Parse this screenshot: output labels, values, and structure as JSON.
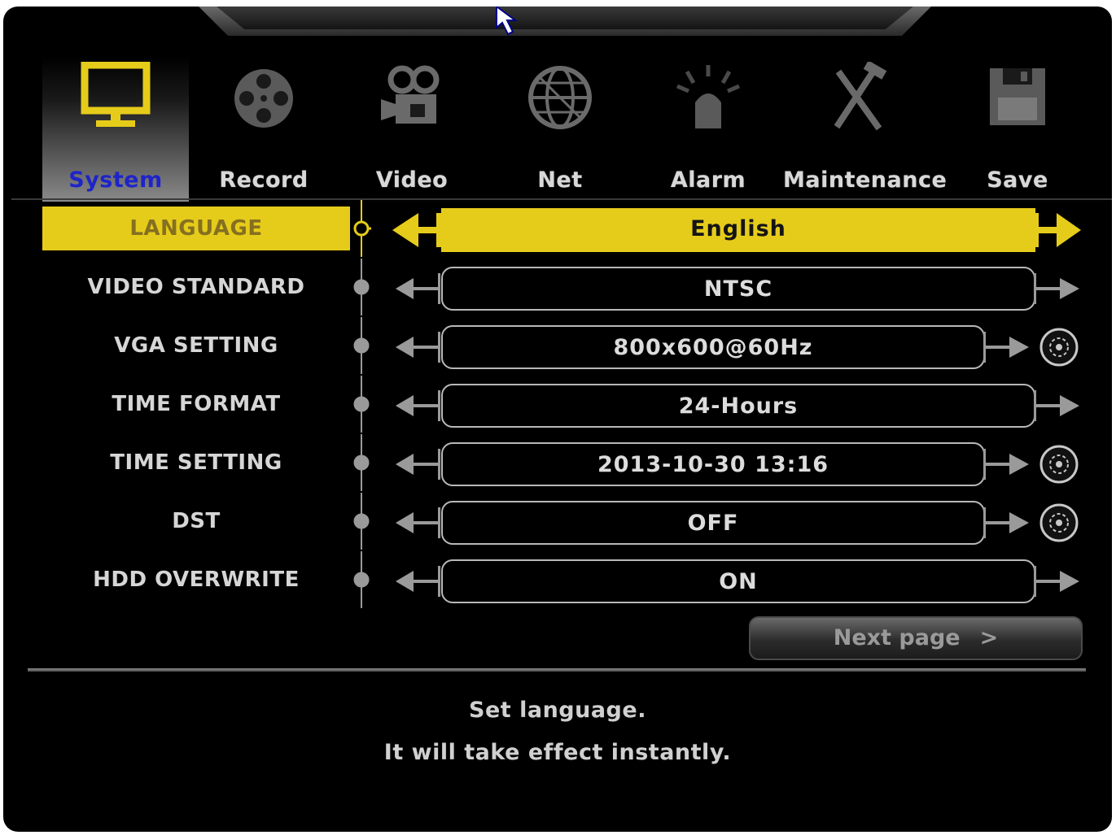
{
  "tabs": [
    {
      "id": "system",
      "label": "System",
      "icon": "monitor-icon",
      "active": true
    },
    {
      "id": "record",
      "label": "Record",
      "icon": "film-reel-icon",
      "active": false
    },
    {
      "id": "video",
      "label": "Video",
      "icon": "video-camera-icon",
      "active": false
    },
    {
      "id": "net",
      "label": "Net",
      "icon": "globe-icon",
      "active": false
    },
    {
      "id": "alarm",
      "label": "Alarm",
      "icon": "alarm-light-icon",
      "active": false
    },
    {
      "id": "maintenance",
      "label": "Maintenance",
      "icon": "tools-icon",
      "active": false
    },
    {
      "id": "save",
      "label": "Save",
      "icon": "floppy-disk-icon",
      "active": false
    }
  ],
  "settings": [
    {
      "label": "LANGUAGE",
      "value": "English",
      "active": true,
      "has_action": false
    },
    {
      "label": "VIDEO STANDARD",
      "value": "NTSC",
      "active": false,
      "has_action": false
    },
    {
      "label": "VGA SETTING",
      "value": "800x600@60Hz",
      "active": false,
      "has_action": true
    },
    {
      "label": "TIME FORMAT",
      "value": "24-Hours",
      "active": false,
      "has_action": false
    },
    {
      "label": "TIME SETTING",
      "value": "2013-10-30 13:16",
      "active": false,
      "has_action": true
    },
    {
      "label": "DST",
      "value": "OFF",
      "active": false,
      "has_action": true
    },
    {
      "label": "HDD OVERWRITE",
      "value": "ON",
      "active": false,
      "has_action": false
    }
  ],
  "next_button": {
    "label": "Next page",
    "chevron": ">"
  },
  "help": {
    "line1": "Set language.",
    "line2": "It will take effect instantly."
  },
  "colors": {
    "accent": "#e6cc1a",
    "active_tab_text": "#1e24c8",
    "background": "#000000"
  }
}
